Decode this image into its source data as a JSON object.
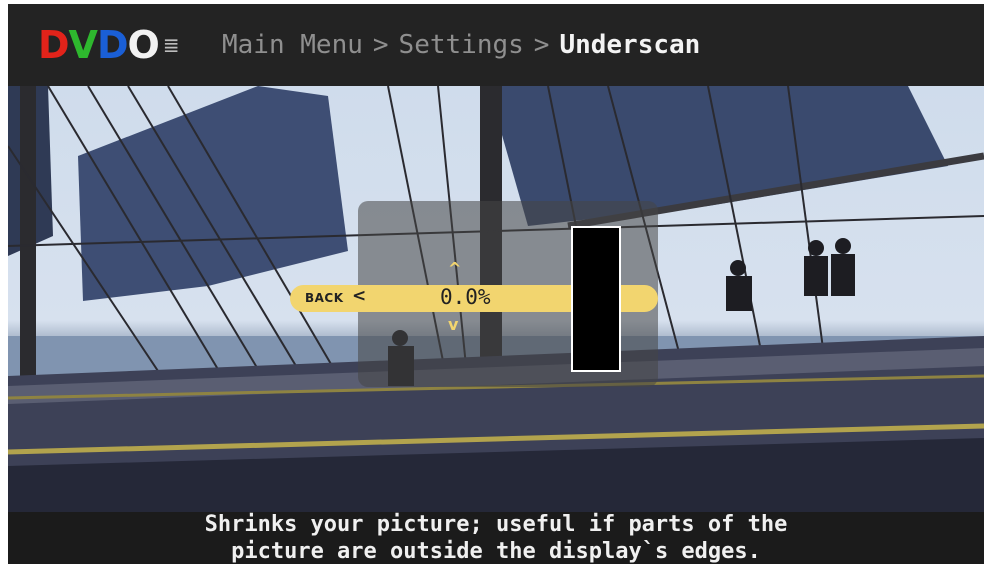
{
  "header": {
    "logo": {
      "letters": [
        "D",
        "V",
        "D",
        "O"
      ],
      "colors": [
        "#e2231a",
        "#2eb82e",
        "#1a5fd6",
        "#f2f2f2"
      ],
      "mark_icon": "equalizer-icon"
    },
    "breadcrumb": [
      "Main Menu",
      "Settings",
      "Underscan"
    ],
    "separator": ">"
  },
  "control": {
    "back_label": "BACK",
    "back_icon": "chevron-left-icon",
    "value": "0.0%",
    "up_icon": "chevron-up-icon",
    "down_icon": "chevron-down-icon",
    "accent_color": "#f2d56f"
  },
  "description": {
    "line1": "Shrinks your picture; useful if parts of the",
    "line2": "picture are outside the display`s edges."
  }
}
